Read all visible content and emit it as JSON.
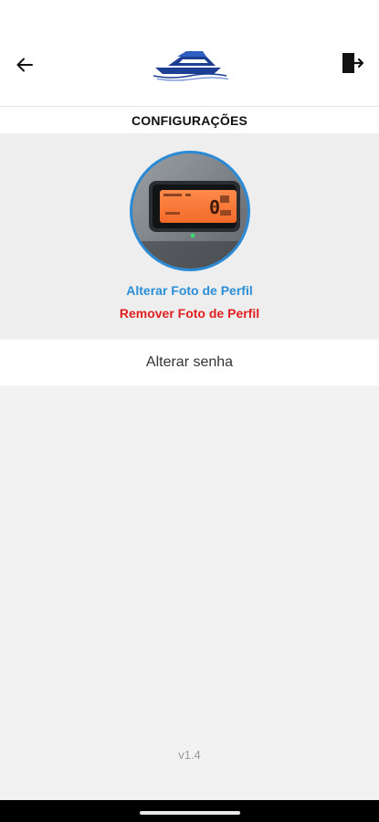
{
  "header": {
    "back_icon": "arrow-left-icon",
    "logo_icon": "boat-logo-icon",
    "logout_icon": "exit-door-icon"
  },
  "title": "CONFIGURAÇÕES",
  "profile": {
    "change_photo_label": "Alterar Foto de Perfil",
    "remove_photo_label": "Remover Foto de Perfil",
    "photo_description": "instrument-display-photo",
    "accent_color": "#2b8fd8",
    "danger_color": "#e02020"
  },
  "password": {
    "label": "Alterar senha"
  },
  "version": "v1.4"
}
